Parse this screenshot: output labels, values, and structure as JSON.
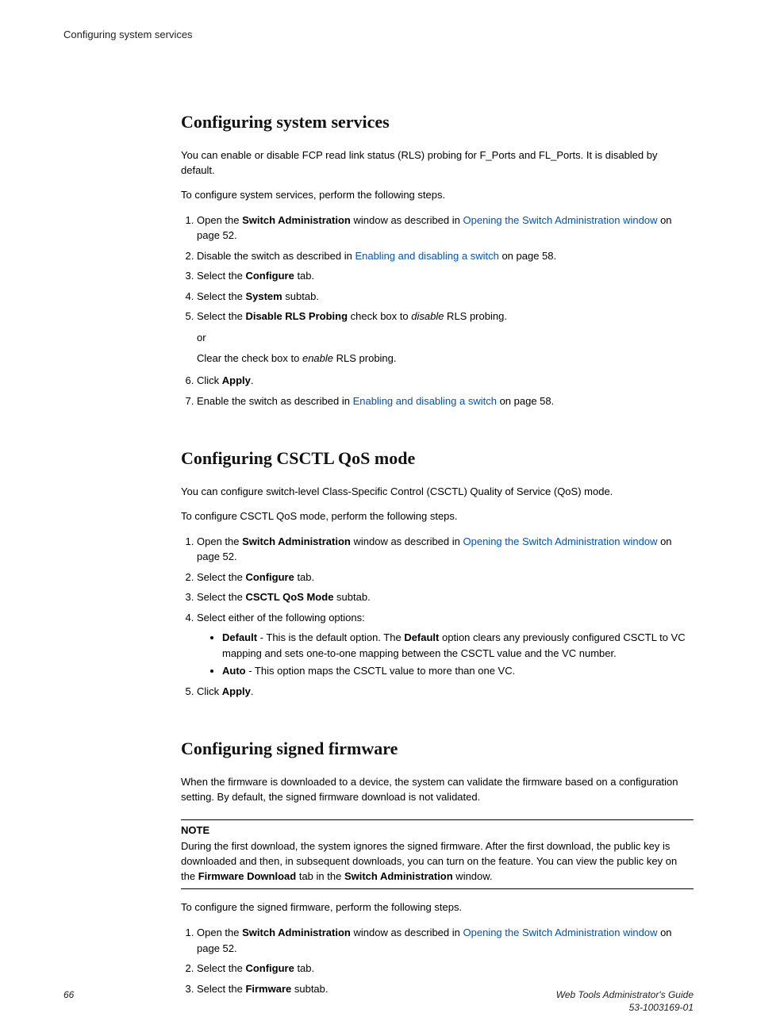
{
  "header": {
    "running": "Configuring system services"
  },
  "section1": {
    "title": "Configuring system services",
    "intro1": "You can enable or disable FCP read link status (RLS) probing for F_Ports and FL_Ports. It is disabled by default.",
    "intro2": "To configure system services, perform the following steps.",
    "step1_a": "Open the ",
    "step1_b": "Switch Administration",
    "step1_c": " window as described in ",
    "step1_link": "Opening the Switch Administration window",
    "step1_d": " on page 52.",
    "step2_a": "Disable the switch as described in ",
    "step2_link": "Enabling and disabling a switch",
    "step2_b": " on page 58.",
    "step3_a": "Select the ",
    "step3_b": "Configure",
    "step3_c": " tab.",
    "step4_a": "Select the ",
    "step4_b": "System",
    "step4_c": " subtab.",
    "step5_a": "Select the ",
    "step5_b": "Disable RLS Probing",
    "step5_c": " check box to ",
    "step5_d": "disable",
    "step5_e": " RLS probing.",
    "step5_or": "or",
    "step5_clear_a": "Clear the check box to ",
    "step5_clear_b": "enable",
    "step5_clear_c": " RLS probing.",
    "step6_a": "Click ",
    "step6_b": "Apply",
    "step6_c": ".",
    "step7_a": "Enable the switch as described in ",
    "step7_link": "Enabling and disabling a switch",
    "step7_b": " on page 58."
  },
  "section2": {
    "title": "Configuring CSCTL QoS mode",
    "intro1": "You can configure switch-level Class-Specific Control (CSCTL) Quality of Service (QoS) mode.",
    "intro2": "To configure CSCTL QoS mode, perform the following steps.",
    "step1_a": "Open the ",
    "step1_b": "Switch Administration",
    "step1_c": " window as described in ",
    "step1_link": "Opening the Switch Administration window",
    "step1_d": " on page 52.",
    "step2_a": "Select the ",
    "step2_b": "Configure",
    "step2_c": " tab.",
    "step3_a": "Select the ",
    "step3_b": "CSCTL QoS Mode",
    "step3_c": " subtab.",
    "step4": "Select either of the following options:",
    "bullet1_a": "Default",
    "bullet1_b": " - This is the default option. The ",
    "bullet1_c": "Default",
    "bullet1_d": " option clears any previously configured CSCTL to VC mapping and sets one-to-one mapping between the CSCTL value and the VC number.",
    "bullet2_a": "Auto",
    "bullet2_b": " - This option maps the CSCTL value to more than one VC.",
    "step5_a": "Click ",
    "step5_b": "Apply",
    "step5_c": "."
  },
  "section3": {
    "title": "Configuring signed firmware",
    "intro1": "When the firmware is downloaded to a device, the system can validate the firmware based on a configuration setting. By default, the signed firmware download is not validated.",
    "note_label": "NOTE",
    "note_a": "During the first download, the system ignores the signed firmware. After the first download, the public key is downloaded and then, in subsequent downloads, you can turn on the feature. You can view the public key on the ",
    "note_b": "Firmware Download",
    "note_c": " tab in the ",
    "note_d": "Switch Administration",
    "note_e": " window.",
    "intro2": "To configure the signed firmware, perform the following steps.",
    "step1_a": "Open the ",
    "step1_b": "Switch Administration",
    "step1_c": " window as described in ",
    "step1_link": "Opening the Switch Administration window",
    "step1_d": " on page 52.",
    "step2_a": "Select the ",
    "step2_b": "Configure",
    "step2_c": " tab.",
    "step3_a": "Select the ",
    "step3_b": "Firmware",
    "step3_c": " subtab."
  },
  "footer": {
    "page": "66",
    "guide": "Web Tools Administrator's Guide",
    "docnum": "53-1003169-01"
  }
}
